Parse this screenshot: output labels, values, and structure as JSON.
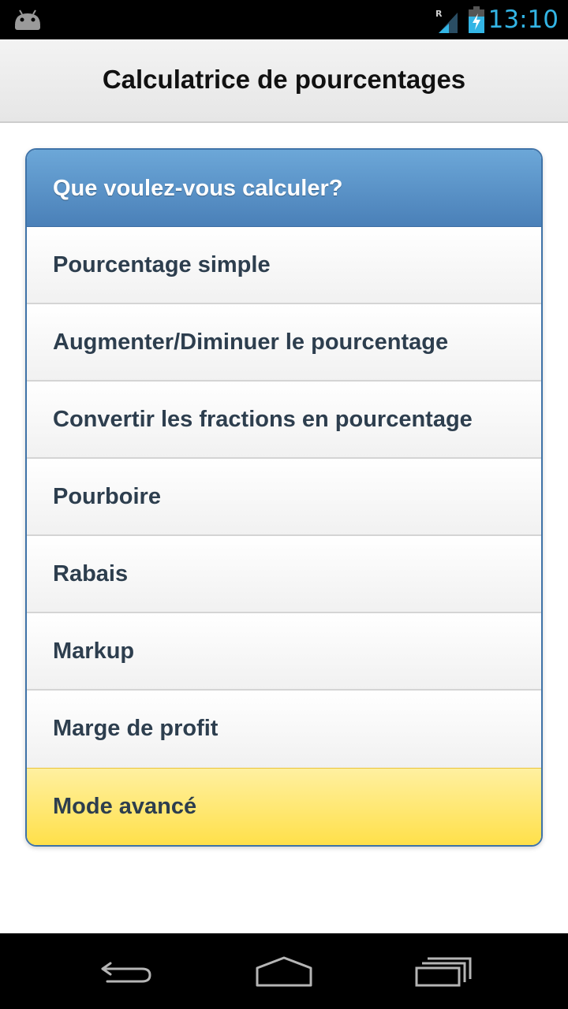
{
  "status_bar": {
    "time": "13:10",
    "roaming_indicator": "R",
    "icons": [
      "android-icon",
      "signal-icon",
      "battery-charging-icon"
    ],
    "accent_color": "#33b5e5"
  },
  "app_bar": {
    "title": "Calculatrice de pourcentages"
  },
  "menu": {
    "header": "Que voulez-vous calculer?",
    "items": [
      {
        "label": "Pourcentage simple"
      },
      {
        "label": "Augmenter/Diminuer le pourcentage"
      },
      {
        "label": "Convertir les fractions en pourcentage"
      },
      {
        "label": "Pourboire"
      },
      {
        "label": "Rabais"
      },
      {
        "label": "Markup"
      },
      {
        "label": "Marge de profit"
      },
      {
        "label": "Mode avancé"
      }
    ],
    "header_color": "#5a93c9",
    "advanced_color": "#ffe98a"
  },
  "nav_bar": {
    "buttons": [
      "back-icon",
      "home-icon",
      "recent-apps-icon"
    ]
  }
}
